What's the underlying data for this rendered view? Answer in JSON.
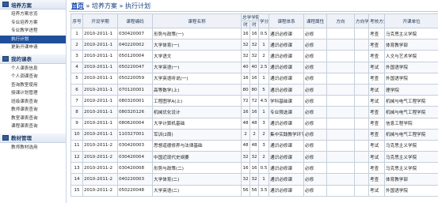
{
  "sidebar": {
    "sections": [
      {
        "title": "培养方案",
        "items": [
          "培养方案总览",
          "专业培养方案",
          "专业教学进程",
          "执行计划",
          "更新开课申请"
        ]
      },
      {
        "title": "我的课表",
        "items": [
          "个人课表信息",
          "个人调课查询",
          "查询教室使用",
          "授课计划管理",
          "班级课表查询",
          "教师课表查询",
          "教室课表查询",
          "课程课表查询"
        ]
      },
      {
        "title": "教材管理",
        "items": [
          "教师教材选用"
        ]
      }
    ],
    "active_item": "执行计划"
  },
  "breadcrumb": {
    "home": "首页",
    "sep1": " » ",
    "section": "培养方案",
    "sep2": " » ",
    "page": "执行计划"
  },
  "table": {
    "headers": {
      "no": "序号",
      "term": "开设学期",
      "code": "课程编码",
      "name": "课程名称",
      "total_hours": "总学学期",
      "hours_sub": [
        "时",
        "时"
      ],
      "credit": "学分",
      "category": "课程体系",
      "nature": "课程属性",
      "direction": "方向",
      "direction_hours": "方向学时",
      "assess": "考核方式",
      "dept": "开课单位"
    },
    "rows": [
      [
        "1",
        "2010-2011-1",
        "030420007",
        "形势与政策(一)",
        "16",
        "16",
        "0.5",
        "通识必修课",
        "必修",
        "",
        "",
        "考查",
        "马克思主义学院"
      ],
      [
        "2",
        "2010-2011-1",
        "040220002",
        "大学体育(一)",
        "32",
        "32",
        "1",
        "通识必修课",
        "必修",
        "",
        "",
        "考查",
        "体育教学部"
      ],
      [
        "3",
        "2010-2011-1",
        "050120004",
        "大学语文",
        "32",
        "32",
        "2",
        "通识必修课",
        "必修",
        "",
        "",
        "考查",
        "人文与艺术学院"
      ],
      [
        "4",
        "2010-2011-1",
        "050220047",
        "大学英语(一)",
        "40",
        "40",
        "2.5",
        "通识必修课",
        "必修",
        "",
        "",
        "考试",
        "外国语学院"
      ],
      [
        "5",
        "2010-2011-1",
        "050220059",
        "大学英语听说(一)",
        "16",
        "16",
        "1",
        "通识必修课",
        "必修",
        "",
        "",
        "考查",
        "外国语学院"
      ],
      [
        "6",
        "2010-2011-1",
        "070120001",
        "高等数学(上)",
        "80",
        "80",
        "5",
        "通识必修课",
        "必修",
        "",
        "",
        "考试",
        "理学院"
      ],
      [
        "7",
        "2010-2011-1",
        "080320001",
        "工程图学A(上)",
        "72",
        "72",
        "4.5",
        "学科基础课",
        "必修",
        "",
        "",
        "考试",
        "机械与电气工程学院"
      ],
      [
        "8",
        "2010-2011-1",
        "080320126",
        "机械优化设计",
        "16",
        "16",
        "1",
        "专业限选课",
        "必修",
        "",
        "",
        "考查",
        "机械与电气工程学院"
      ],
      [
        "9",
        "2010-2011-1",
        "080620004",
        "大学计算机基础",
        "48",
        "48",
        "3",
        "通识必修课",
        "必修",
        "",
        "",
        "考查",
        "信息工程学院"
      ],
      [
        "10",
        "2010-2011-1",
        "110327001",
        "军训(2周)",
        "2",
        "2",
        "2",
        "集中实践教学环节",
        "必修",
        "",
        "",
        "考查",
        "机械与电气工程学院"
      ],
      [
        "11",
        "2010-2011-2",
        "030420003",
        "思想道德修养与法律基础",
        "48",
        "48",
        "3",
        "通识必修课",
        "必修",
        "",
        "",
        "考试",
        "马克思主义学院"
      ],
      [
        "12",
        "2010-2011-2",
        "030420004",
        "中国近现代史纲要",
        "32",
        "32",
        "2",
        "通识必修课",
        "必修",
        "",
        "",
        "考试",
        "马克思主义学院"
      ],
      [
        "13",
        "2010-2011-2",
        "030420008",
        "形势与政策(二)",
        "16",
        "16",
        "0.5",
        "通识必修课",
        "必修",
        "",
        "",
        "考查",
        "马克思主义学院"
      ],
      [
        "14",
        "2010-2011-2",
        "040220003",
        "大学体育(二)",
        "32",
        "32",
        "1",
        "通识必修课",
        "必修",
        "",
        "",
        "考查",
        "体育教学部"
      ],
      [
        "15",
        "2010-2011-2",
        "050220048",
        "大学英语(二)",
        "56",
        "56",
        "3.5",
        "通识必修课",
        "必修",
        "",
        "",
        "考试",
        "外国语学院"
      ]
    ]
  }
}
